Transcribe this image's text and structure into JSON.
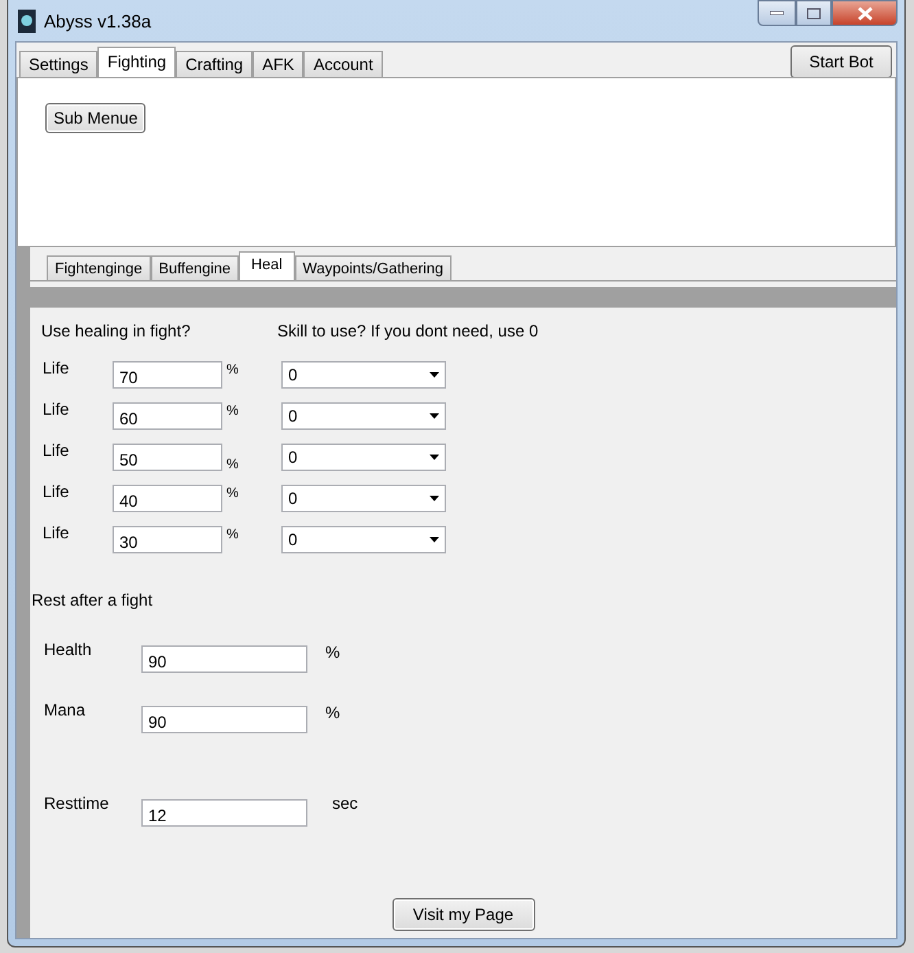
{
  "window": {
    "title": "Abyss v1.38a"
  },
  "tabs": [
    {
      "label": "Settings",
      "selected": false
    },
    {
      "label": "Fighting",
      "selected": true
    },
    {
      "label": "Crafting",
      "selected": false
    },
    {
      "label": "AFK",
      "selected": false
    },
    {
      "label": "Account",
      "selected": false
    }
  ],
  "start_button": "Start Bot",
  "sub_menu_button": "Sub Menue",
  "sub_tabs": [
    {
      "label": "Fightenginge",
      "selected": false
    },
    {
      "label": "Buffengine",
      "selected": false
    },
    {
      "label": "Heal",
      "selected": true
    },
    {
      "label": "Waypoints/Gathering",
      "selected": false
    }
  ],
  "heal": {
    "heading": "Use healing in fight?",
    "skill_heading": "Skill to use? If you dont need, use 0",
    "rows": [
      {
        "label": "Life",
        "value": "70",
        "unit": "%",
        "skill": "0"
      },
      {
        "label": "Life",
        "value": "60",
        "unit": "%",
        "skill": "0"
      },
      {
        "label": "Life",
        "value": "50",
        "unit": "%",
        "skill": "0"
      },
      {
        "label": "Life",
        "value": "40",
        "unit": "%",
        "skill": "0"
      },
      {
        "label": "Life",
        "value": "30",
        "unit": "%",
        "skill": "0"
      }
    ],
    "rest_heading": "Rest after a fight",
    "rest_fields": [
      {
        "label": "Health",
        "value": "90",
        "unit": "%"
      },
      {
        "label": "Mana",
        "value": "90",
        "unit": "%"
      },
      {
        "label": "Resttime",
        "value": "12",
        "unit": "sec"
      }
    ]
  },
  "visit_button": "Visit my Page"
}
